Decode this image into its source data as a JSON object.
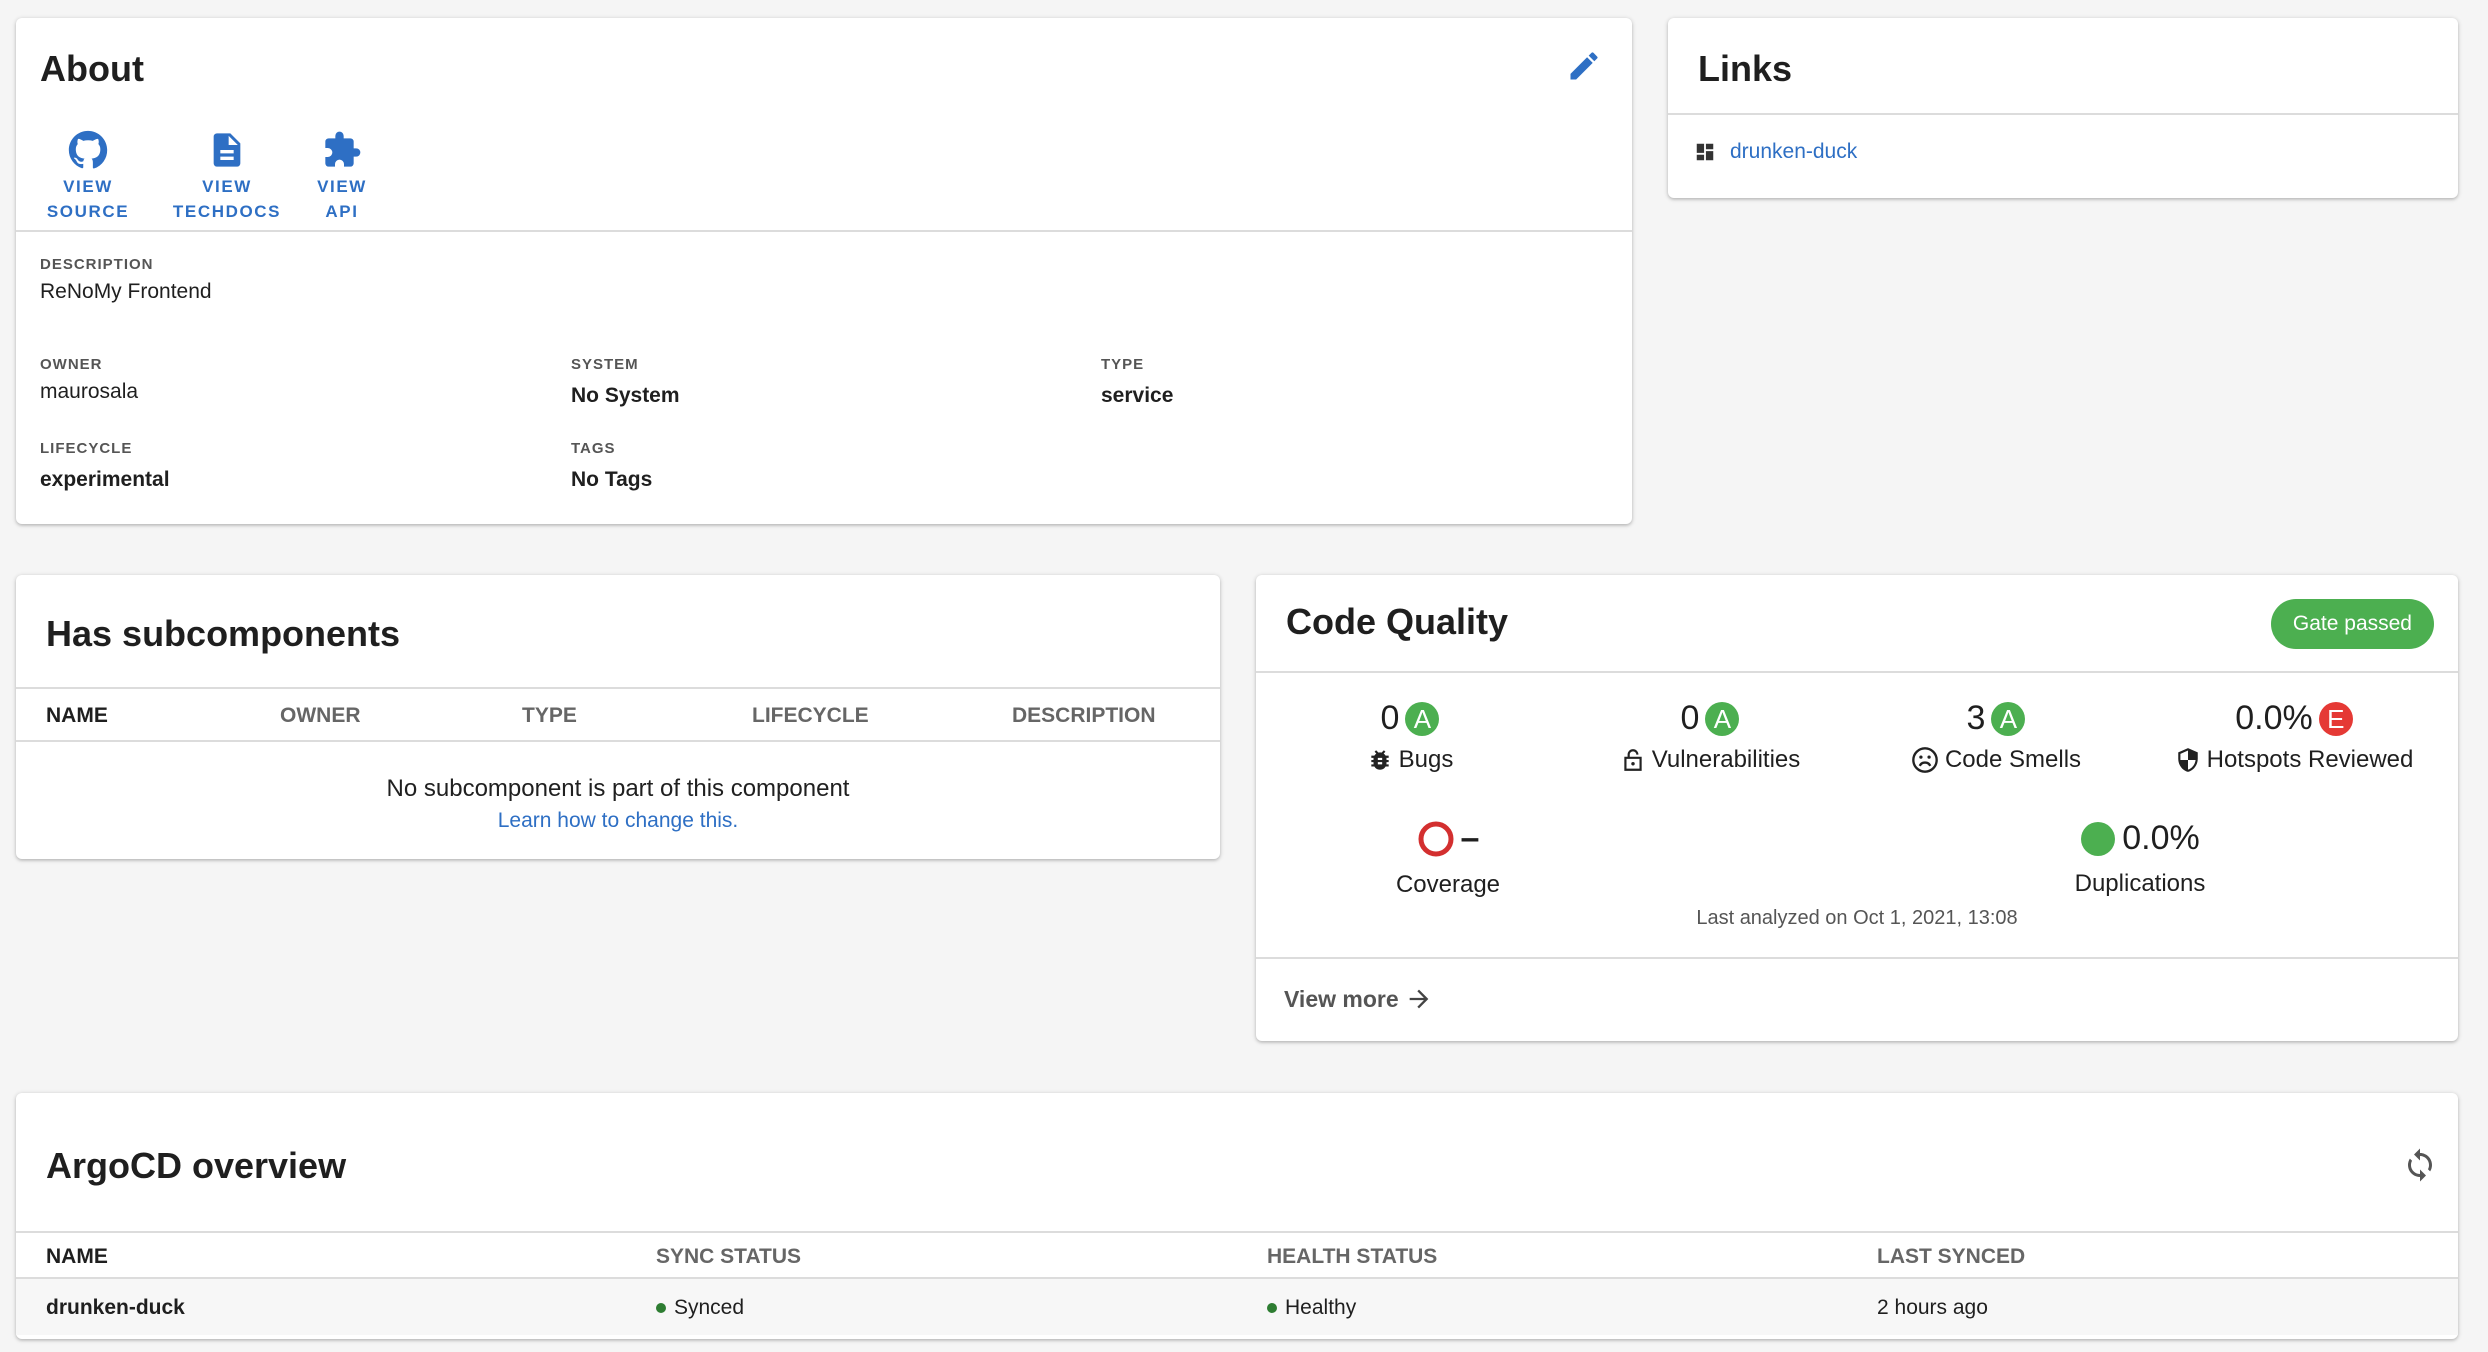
{
  "about": {
    "title": "About",
    "actions": [
      {
        "line1": "VIEW",
        "line2": "SOURCE",
        "icon": "github-icon"
      },
      {
        "line1": "VIEW",
        "line2": "TECHDOCS",
        "icon": "document-icon"
      },
      {
        "line1": "VIEW",
        "line2": "API",
        "icon": "puzzle-icon"
      }
    ],
    "description_label": "DESCRIPTION",
    "description": "ReNoMy Frontend",
    "owner_label": "OWNER",
    "owner": "maurosala",
    "system_label": "SYSTEM",
    "system": "No System",
    "type_label": "TYPE",
    "type": "service",
    "lifecycle_label": "LIFECYCLE",
    "lifecycle": "experimental",
    "tags_label": "TAGS",
    "tags": "No Tags"
  },
  "links": {
    "title": "Links",
    "items": [
      {
        "label": "drunken-duck",
        "icon": "dashboard-icon"
      }
    ]
  },
  "subcomponents": {
    "title": "Has subcomponents",
    "columns": [
      "NAME",
      "OWNER",
      "TYPE",
      "LIFECYCLE",
      "DESCRIPTION"
    ],
    "empty_text": "No subcomponent is part of this component",
    "learn_link": "Learn how to change this."
  },
  "code_quality": {
    "title": "Code Quality",
    "gate": "Gate passed",
    "metrics": [
      {
        "value": "0",
        "rating": "A",
        "label": "Bugs",
        "icon": "bug-icon"
      },
      {
        "value": "0",
        "rating": "A",
        "label": "Vulnerabilities",
        "icon": "lock-icon"
      },
      {
        "value": "3",
        "rating": "A",
        "label": "Code Smells",
        "icon": "sad-face-icon"
      },
      {
        "value": "0.0%",
        "rating": "E",
        "label": "Hotspots Reviewed",
        "icon": "shield-icon"
      }
    ],
    "coverage": {
      "value": "–",
      "label": "Coverage"
    },
    "duplications": {
      "value": "0.0%",
      "label": "Duplications"
    },
    "last_analyzed": "Last analyzed on Oct 1, 2021, 13:08",
    "view_more": "View more",
    "colors": {
      "rating_a": "#4caf50",
      "rating_e": "#e53935",
      "coverage_ring": "#d32f2f",
      "gate": "#4caf50"
    }
  },
  "argocd": {
    "title": "ArgoCD overview",
    "columns": [
      "NAME",
      "SYNC STATUS",
      "HEALTH STATUS",
      "LAST SYNCED"
    ],
    "rows": [
      {
        "name": "drunken-duck",
        "sync": "Synced",
        "health": "Healthy",
        "last_synced": "2 hours ago"
      }
    ]
  }
}
